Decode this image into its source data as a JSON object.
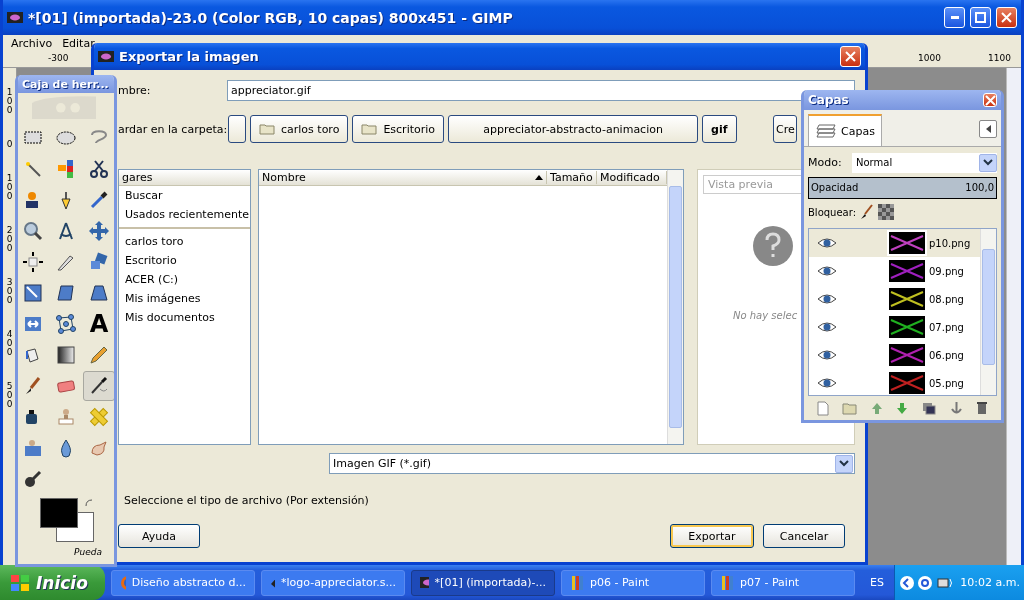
{
  "main_window": {
    "title": "*[01] (importada)-23.0 (Color RGB, 10 capas) 800x451 - GIMP",
    "menu": [
      "Archivo",
      "Editar"
    ],
    "ruler_labels": [
      "-300",
      "1000",
      "1100"
    ],
    "vertical_ruler_labels": [
      "100",
      "0",
      "100",
      "200",
      "300",
      "400",
      "500"
    ]
  },
  "toolbox": {
    "title": "Caja de herr...",
    "tools": [
      {
        "kind": "rect",
        "selected": false
      },
      {
        "kind": "ellipse",
        "selected": false
      },
      {
        "kind": "lasso",
        "selected": false
      },
      {
        "kind": "wand",
        "selected": false
      },
      {
        "kind": "squares",
        "selected": false
      },
      {
        "kind": "scissors",
        "selected": false
      },
      {
        "kind": "person",
        "selected": false
      },
      {
        "kind": "pen",
        "selected": false
      },
      {
        "kind": "dropper",
        "selected": false
      },
      {
        "kind": "magnifier",
        "selected": false
      },
      {
        "kind": "compass",
        "selected": false
      },
      {
        "kind": "move",
        "selected": false
      },
      {
        "kind": "align",
        "selected": false
      },
      {
        "kind": "knife",
        "selected": false
      },
      {
        "kind": "rotate",
        "selected": false
      },
      {
        "kind": "scale",
        "selected": false
      },
      {
        "kind": "shear",
        "selected": false
      },
      {
        "kind": "perspective",
        "selected": false
      },
      {
        "kind": "flip",
        "selected": false
      },
      {
        "kind": "nodes",
        "selected": false
      },
      {
        "kind": "letter",
        "glyph": "A",
        "selected": false
      },
      {
        "kind": "bucket",
        "selected": false
      },
      {
        "kind": "gradient",
        "selected": false
      },
      {
        "kind": "pencil",
        "selected": false
      },
      {
        "kind": "brush",
        "selected": false
      },
      {
        "kind": "eraser",
        "selected": false
      },
      {
        "kind": "airbrush",
        "selected": true
      },
      {
        "kind": "ink",
        "selected": false
      },
      {
        "kind": "stamp",
        "selected": false
      },
      {
        "kind": "bandage",
        "selected": false
      },
      {
        "kind": "stamp2",
        "selected": false
      },
      {
        "kind": "drop",
        "selected": false
      },
      {
        "kind": "finger",
        "selected": false
      },
      {
        "kind": "dodge",
        "selected": false
      }
    ],
    "footer": "Pueda"
  },
  "dialog": {
    "title": "Exportar la imagen",
    "name_label": "mbre:",
    "name_value": "appreciator.gif",
    "folder_label": "ardar en la carpeta:",
    "path": [
      {
        "label": "carlos toro",
        "folder": true,
        "selected": false
      },
      {
        "label": "Escritorio",
        "folder": true,
        "selected": false
      },
      {
        "label": "appreciator-abstracto-animacion",
        "folder": false,
        "selected": false
      },
      {
        "label": "gif",
        "folder": false,
        "selected": true
      }
    ],
    "create_button": "Cre",
    "places_header": "gares",
    "places": [
      "Buscar",
      "Usados recientemente",
      "carlos toro",
      "Escritorio",
      "ACER (C:)",
      "Mis imágenes",
      "Mis documentos"
    ],
    "columns": [
      "Nombre",
      "Tamaño",
      "Modificado"
    ],
    "preview_label": "Vista previa",
    "preview_text": "No hay selec",
    "filter": "Imagen GIF (*.gif)",
    "expander": "Seleccione el tipo de archivo (Por extensión)",
    "buttons": [
      "Ayuda",
      "Exportar",
      "Cancelar"
    ]
  },
  "layers": {
    "title": "Capas",
    "tab": "Capas",
    "mode_label": "Modo:",
    "mode": "Normal",
    "opacity": {
      "label": "Opacidad",
      "value": "100,0",
      "level": 1
    },
    "lock_label": "Bloquear:",
    "items": [
      {
        "name": "p10.png",
        "color": "#c040c0",
        "visible": true,
        "selected": true
      },
      {
        "name": "09.png",
        "color": "#a020c0",
        "visible": true,
        "selected": false
      },
      {
        "name": "08.png",
        "color": "#c0c020",
        "visible": true,
        "selected": false
      },
      {
        "name": "07.png",
        "color": "#20b020",
        "visible": true,
        "selected": false
      },
      {
        "name": "06.png",
        "color": "#b020b0",
        "visible": true,
        "selected": false
      },
      {
        "name": "05.png",
        "color": "#c02020",
        "visible": true,
        "selected": false
      }
    ]
  },
  "taskbar": {
    "start": "Inicio",
    "tasks": [
      {
        "label": "Diseño abstracto d...",
        "kind": "browser",
        "selected": false
      },
      {
        "label": "*logo-appreciator.s...",
        "kind": "vector",
        "selected": false
      },
      {
        "label": "*[01] (importada)-...",
        "kind": "gimp",
        "selected": true
      },
      {
        "label": "p06 - Paint",
        "kind": "paint",
        "selected": false
      },
      {
        "label": "p07 - Paint",
        "kind": "paint",
        "selected": false
      }
    ],
    "language": "ES",
    "time": "10:02 a.m."
  }
}
